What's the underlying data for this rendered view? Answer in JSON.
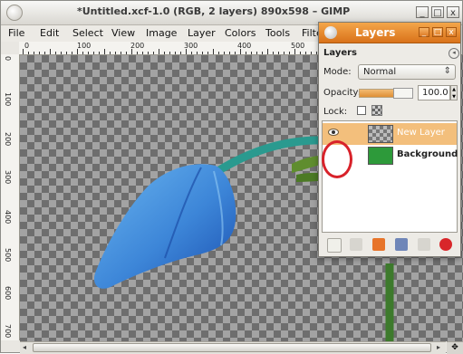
{
  "window": {
    "title": "*Untitled.xcf-1.0 (RGB, 2 layers) 890x598 – GIMP",
    "controls": [
      "_",
      "□",
      "x"
    ]
  },
  "menubar": {
    "items": [
      {
        "label": "File"
      },
      {
        "label": "Edit"
      },
      {
        "label": "Select"
      },
      {
        "label": "View"
      },
      {
        "label": "Image"
      },
      {
        "label": "Layer"
      },
      {
        "label": "Colors"
      },
      {
        "label": "Tools"
      },
      {
        "label": "Filte"
      }
    ]
  },
  "rulers": {
    "horizontal": [
      "0",
      "100",
      "200",
      "300",
      "400",
      "500"
    ],
    "vertical": [
      "0",
      "100",
      "200",
      "300",
      "400",
      "500",
      "600",
      "700"
    ]
  },
  "canvas": {
    "colors": {
      "petal_light": "#5aa8e8",
      "petal_dark": "#1d55b8",
      "stem": "#2a9a8f",
      "stem_green": "#3d7a2c"
    }
  },
  "layers_dock": {
    "title": "Layers",
    "tab_label": "Layers",
    "mode_label": "Mode:",
    "mode_value": "Normal",
    "opacity_label": "Opacity:",
    "opacity_value": "100.0",
    "opacity_fraction": 1.0,
    "lock_label": "Lock:",
    "layers": [
      {
        "name": "New Layer",
        "selected": true,
        "visible": true,
        "thumb": "transparent"
      },
      {
        "name": "Background",
        "selected": false,
        "visible": false,
        "thumb": "green"
      }
    ],
    "toolbar_icons": [
      "new-layer-icon",
      "raise-layer-icon",
      "lower-layer-icon",
      "duplicate-layer-icon",
      "anchor-layer-icon",
      "delete-layer-icon"
    ],
    "accent_color": "#e98b2c"
  },
  "annotation": {
    "color": "#d8222a"
  }
}
